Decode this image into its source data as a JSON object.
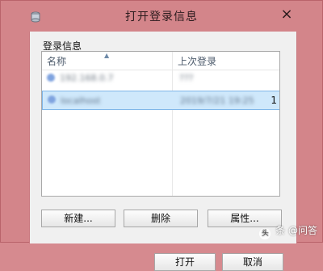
{
  "window": {
    "title": "打开登录信息",
    "close_glyph": "×",
    "accent_color": "#d3858a"
  },
  "group": {
    "label": "登录信息"
  },
  "list": {
    "columns": [
      "名称",
      "上次登录"
    ],
    "rows": [
      {
        "name": "192.168.0.7",
        "last_login": "???"
      },
      {
        "name": "localhost",
        "last_login": "2019/7/21 19:25",
        "tail": "1"
      }
    ],
    "selected_row_index": 1
  },
  "buttons": {
    "new_label": "新建...",
    "delete_label": "删除",
    "props_label": "属性...",
    "open_label": "打开",
    "cancel_label": "取消"
  },
  "watermark": {
    "logo": "头",
    "text": "条 @问答"
  }
}
